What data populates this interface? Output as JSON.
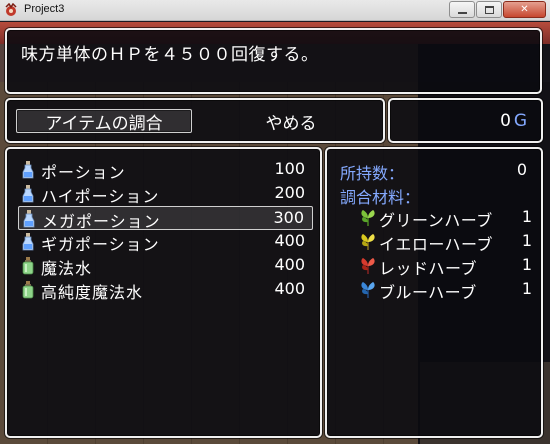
{
  "window": {
    "title": "Project3",
    "buttons": [
      "minimize-icon",
      "maximize-icon",
      "close-icon"
    ]
  },
  "help": {
    "text": "味方単体のＨＰを４５００回復する。"
  },
  "commands": [
    {
      "label": "アイテムの調合",
      "selected": true
    },
    {
      "label": "やめる",
      "selected": false
    }
  ],
  "gold": {
    "value": "0",
    "unit": "G"
  },
  "items": [
    {
      "name": "ポーション",
      "price": "100",
      "icon": "potion-icon"
    },
    {
      "name": "ハイポーション",
      "price": "200",
      "icon": "potion-icon"
    },
    {
      "name": "メガポーション",
      "price": "300",
      "icon": "potion-icon",
      "selected": true
    },
    {
      "name": "ギガポーション",
      "price": "400",
      "icon": "potion-icon"
    },
    {
      "name": "魔法水",
      "price": "400",
      "icon": "bottle-icon"
    },
    {
      "name": "高純度魔法水",
      "price": "400",
      "icon": "bottle-icon"
    }
  ],
  "info": {
    "owned_label": "所持数：",
    "owned_value": "0",
    "materials_label": "調合材料：",
    "materials": [
      {
        "name": "グリーンハーブ",
        "qty": "1",
        "icon": "green-herb-icon",
        "color": "#7cc23a"
      },
      {
        "name": "イエローハーブ",
        "qty": "1",
        "icon": "yellow-herb-icon",
        "color": "#d8c81e"
      },
      {
        "name": "レッドハーブ",
        "qty": "1",
        "icon": "red-herb-icon",
        "color": "#d63a2e"
      },
      {
        "name": "ブルーハーブ",
        "qty": "1",
        "icon": "blue-herb-icon",
        "color": "#3a86d8"
      }
    ]
  },
  "colors": {
    "system_text": "#84a9ff",
    "window_border": "#f0f0f0",
    "window_bg": "#0a0a10"
  }
}
